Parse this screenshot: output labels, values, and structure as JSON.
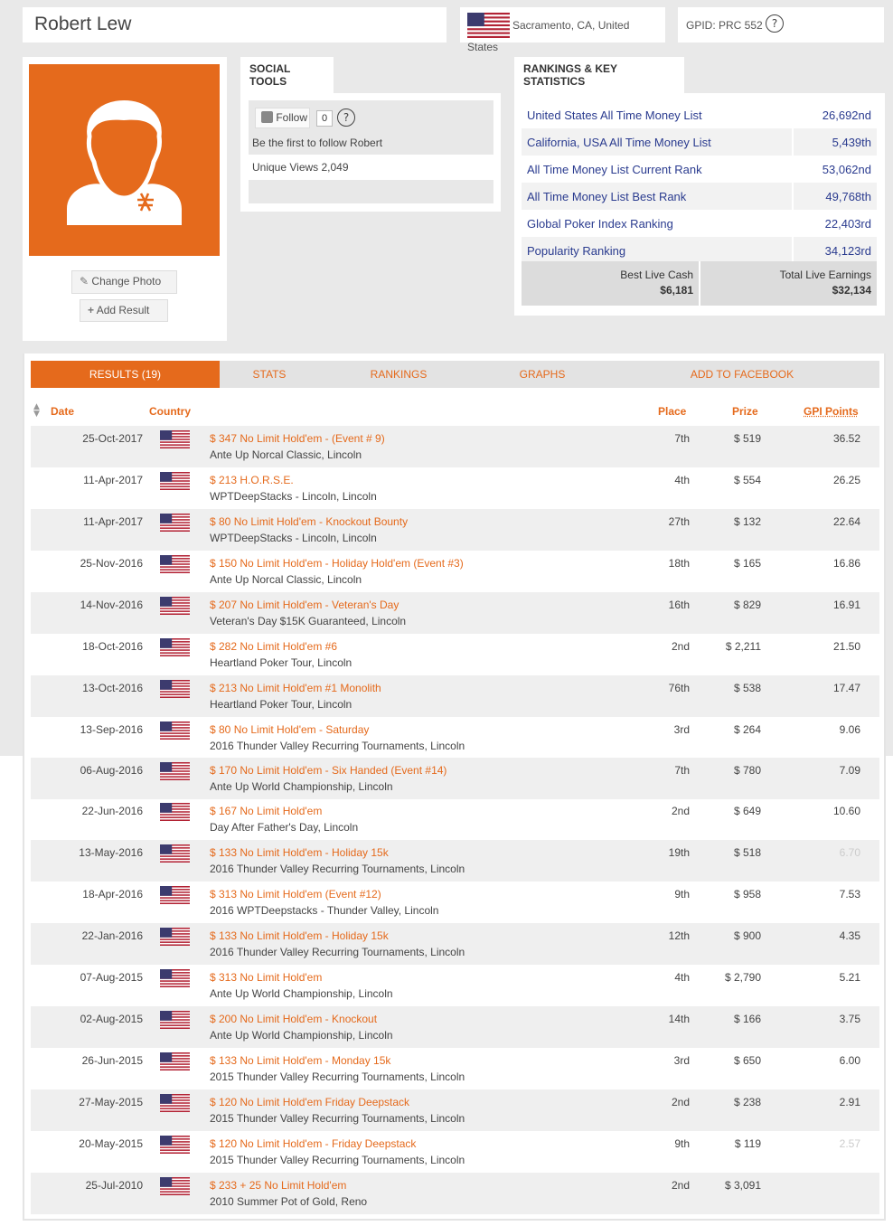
{
  "player": {
    "name": "Robert Lew",
    "location_line1": "Sacramento, CA, United",
    "location_line2": "States",
    "gpid_label": "GPID: PRC 552",
    "help": "?"
  },
  "photo": {
    "change_photo": "Change Photo",
    "add_result": "Add Result"
  },
  "social": {
    "title": "SOCIAL TOOLS",
    "follow_label": "Follow",
    "follow_count": "0",
    "help": "?",
    "first_follow": "Be the first to follow Robert",
    "unique_views": "Unique Views 2,049"
  },
  "rankings": {
    "title": "RANKINGS & KEY STATISTICS",
    "rows": [
      {
        "label": "United States All Time Money List",
        "value": "26,692nd"
      },
      {
        "label": "California, USA All Time Money List",
        "value": "5,439th"
      },
      {
        "label": "All Time Money List Current Rank",
        "value": "53,062nd"
      },
      {
        "label": "All Time Money List Best Rank",
        "value": "49,768th"
      },
      {
        "label": "Global Poker Index Ranking",
        "value": "22,403rd"
      },
      {
        "label": "Popularity Ranking",
        "value": "34,123rd"
      }
    ],
    "best_live_cash_label": "Best Live Cash",
    "best_live_cash_value": "$6,181",
    "total_live_earnings_label": "Total Live Earnings",
    "total_live_earnings_value": "$32,134"
  },
  "tabs": [
    "RESULTS (19)",
    "STATS",
    "RANKINGS",
    "GRAPHS",
    "ADD TO FACEBOOK"
  ],
  "table": {
    "headers": {
      "date": "Date",
      "country": "Country",
      "place": "Place",
      "prize": "Prize",
      "gpi": "GPI Points"
    },
    "rows": [
      {
        "date": "25-Oct-2017",
        "event": "$ 347 No Limit Hold'em - (Event # 9)",
        "venue": "Ante Up Norcal Classic, Lincoln",
        "place": "7th",
        "prize": "$ 519",
        "gpi": "36.52"
      },
      {
        "date": "11-Apr-2017",
        "event": "$ 213 H.O.R.S.E.",
        "venue": "WPTDeepStacks - Lincoln, Lincoln",
        "place": "4th",
        "prize": "$ 554",
        "gpi": "26.25"
      },
      {
        "date": "11-Apr-2017",
        "event": "$ 80 No Limit Hold'em - Knockout Bounty",
        "venue": "WPTDeepStacks - Lincoln, Lincoln",
        "place": "27th",
        "prize": "$ 132",
        "gpi": "22.64"
      },
      {
        "date": "25-Nov-2016",
        "event": "$ 150 No Limit Hold'em - Holiday Hold'em (Event #3)",
        "venue": "Ante Up Norcal Classic, Lincoln",
        "place": "18th",
        "prize": "$ 165",
        "gpi": "16.86"
      },
      {
        "date": "14-Nov-2016",
        "event": "$ 207 No Limit Hold'em - Veteran's Day",
        "venue": "Veteran's Day $15K Guaranteed, Lincoln",
        "place": "16th",
        "prize": "$ 829",
        "gpi": "16.91"
      },
      {
        "date": "18-Oct-2016",
        "event": "$ 282 No Limit Hold'em #6",
        "venue": "Heartland Poker Tour, Lincoln",
        "place": "2nd",
        "prize": "$ 2,211",
        "gpi": "21.50"
      },
      {
        "date": "13-Oct-2016",
        "event": "$ 213 No Limit Hold'em #1 Monolith",
        "venue": "Heartland Poker Tour, Lincoln",
        "place": "76th",
        "prize": "$ 538",
        "gpi": "17.47"
      },
      {
        "date": "13-Sep-2016",
        "event": "$ 80 No Limit Hold'em - Saturday",
        "venue": "2016 Thunder Valley Recurring Tournaments, Lincoln",
        "place": "3rd",
        "prize": "$ 264",
        "gpi": "9.06"
      },
      {
        "date": "06-Aug-2016",
        "event": "$ 170 No Limit Hold'em - Six Handed (Event #14)",
        "venue": "Ante Up World Championship, Lincoln",
        "place": "7th",
        "prize": "$ 780",
        "gpi": "7.09"
      },
      {
        "date": "22-Jun-2016",
        "event": "$ 167 No Limit Hold'em",
        "venue": "Day After Father's Day, Lincoln",
        "place": "2nd",
        "prize": "$ 649",
        "gpi": "10.60"
      },
      {
        "date": "13-May-2016",
        "event": "$ 133 No Limit Hold'em - Holiday 15k",
        "venue": "2016 Thunder Valley Recurring Tournaments, Lincoln",
        "place": "19th",
        "prize": "$ 518",
        "gpi": "6.70",
        "dim": true
      },
      {
        "date": "18-Apr-2016",
        "event": "$ 313 No Limit Hold'em (Event #12)",
        "venue": "2016 WPTDeepstacks - Thunder Valley, Lincoln",
        "place": "9th",
        "prize": "$ 958",
        "gpi": "7.53"
      },
      {
        "date": "22-Jan-2016",
        "event": "$ 133 No Limit Hold'em - Holiday 15k",
        "venue": "2016 Thunder Valley Recurring Tournaments, Lincoln",
        "place": "12th",
        "prize": "$ 900",
        "gpi": "4.35"
      },
      {
        "date": "07-Aug-2015",
        "event": "$ 313 No Limit Hold'em",
        "venue": "Ante Up World Championship, Lincoln",
        "place": "4th",
        "prize": "$ 2,790",
        "gpi": "5.21"
      },
      {
        "date": "02-Aug-2015",
        "event": "$ 200 No Limit Hold'em - Knockout",
        "venue": "Ante Up World Championship, Lincoln",
        "place": "14th",
        "prize": "$ 166",
        "gpi": "3.75"
      },
      {
        "date": "26-Jun-2015",
        "event": "$ 133 No Limit Hold'em - Monday 15k",
        "venue": "2015 Thunder Valley Recurring Tournaments, Lincoln",
        "place": "3rd",
        "prize": "$ 650",
        "gpi": "6.00"
      },
      {
        "date": "27-May-2015",
        "event": "$ 120 No Limit Hold'em Friday Deepstack",
        "venue": "2015 Thunder Valley Recurring Tournaments, Lincoln",
        "place": "2nd",
        "prize": "$ 238",
        "gpi": "2.91"
      },
      {
        "date": "20-May-2015",
        "event": "$ 120 No Limit Hold'em - Friday Deepstack",
        "venue": "2015 Thunder Valley Recurring Tournaments, Lincoln",
        "place": "9th",
        "prize": "$ 119",
        "gpi": "2.57",
        "dim": true
      },
      {
        "date": "25-Jul-2010",
        "event": "$ 233 + 25 No Limit Hold'em",
        "venue": "2010 Summer Pot of Gold, Reno",
        "place": "2nd",
        "prize": "$ 3,091",
        "gpi": ""
      }
    ]
  },
  "colors": {
    "accent": "#e56a1c",
    "link_blue": "#2a3b8f"
  }
}
